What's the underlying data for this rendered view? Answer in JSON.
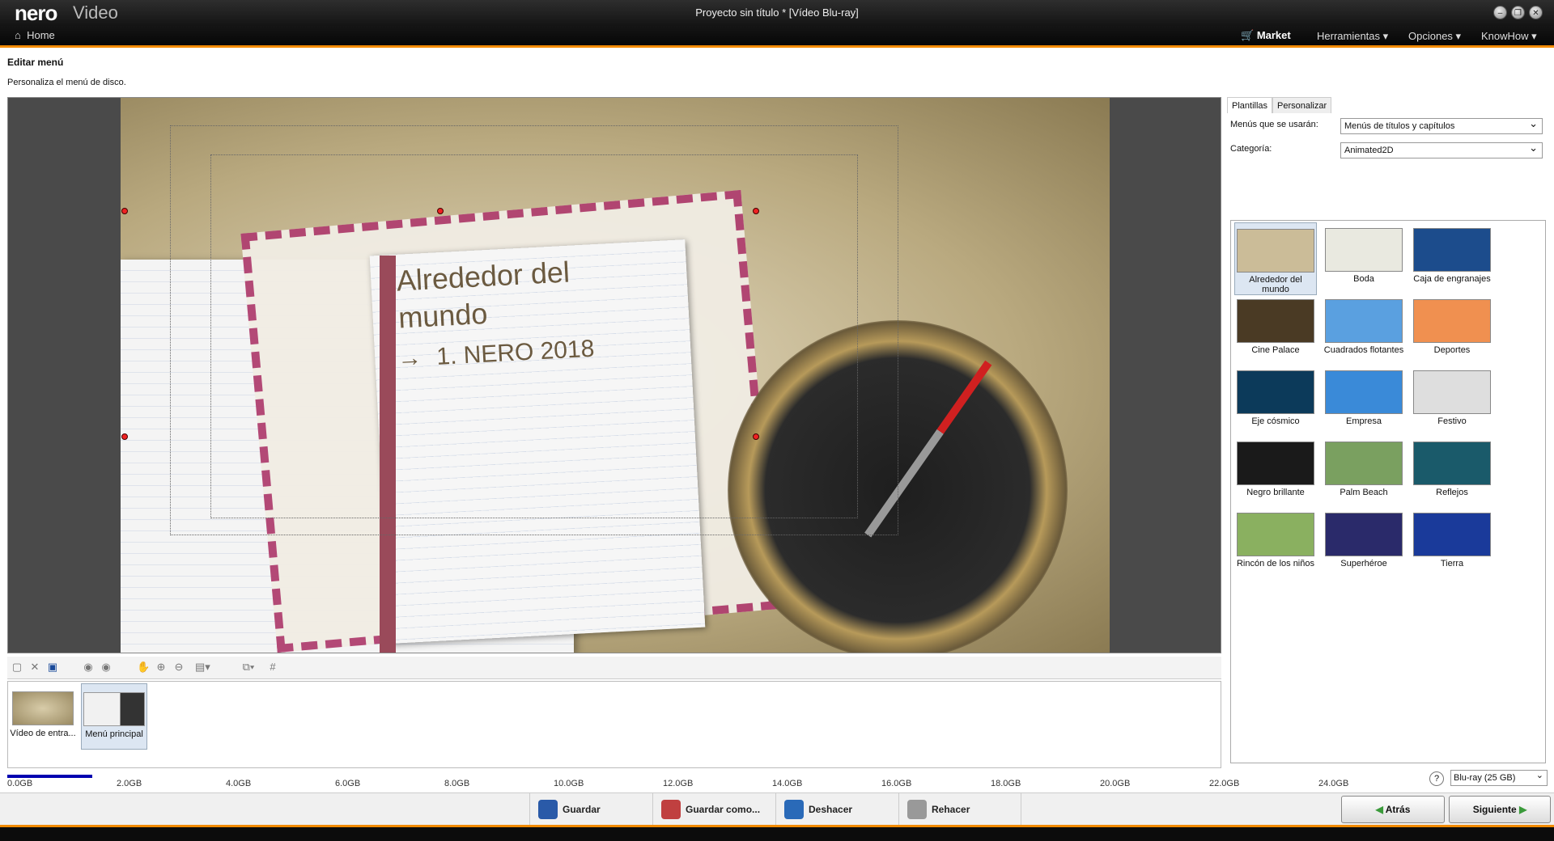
{
  "app": {
    "brand": "nero",
    "name": "Video",
    "title": "Proyecto sin título * [Vídeo Blu-ray]"
  },
  "menubar": {
    "home": "Home",
    "market": "Market",
    "items": [
      "Herramientas ▾",
      "Opciones ▾",
      "KnowHow ▾"
    ]
  },
  "page": {
    "title": "Editar menú",
    "description": "Personaliza el menú de disco."
  },
  "preview": {
    "heading_line1": "Alrededor del",
    "heading_line2": "mundo",
    "item": "1. NERO 2018",
    "arrow": "→"
  },
  "toolbar": {
    "icons": [
      "new-icon",
      "delete-icon",
      "save-icon",
      "back-icon",
      "forward-icon",
      "hand-icon",
      "zoom-in-icon",
      "zoom-out-icon",
      "layout-icon",
      "arrange-icon",
      "grid-icon"
    ]
  },
  "thumbnails": [
    {
      "label": "Vídeo de entra..."
    },
    {
      "label": "Menú principal"
    }
  ],
  "capacity": {
    "used_fraction": 0.07,
    "ticks": [
      "0.0GB",
      "2.0GB",
      "4.0GB",
      "6.0GB",
      "8.0GB",
      "10.0GB",
      "12.0GB",
      "14.0GB",
      "16.0GB",
      "18.0GB",
      "20.0GB",
      "22.0GB",
      "24.0GB"
    ],
    "disc": "Blu-ray (25 GB)"
  },
  "actions": {
    "save": "Guardar",
    "save_as": "Guardar como...",
    "undo": "Deshacer",
    "redo": "Rehacer"
  },
  "nav": {
    "back": "Atrás",
    "next": "Siguiente"
  },
  "panel": {
    "tabs": [
      "Plantillas",
      "Personalizar"
    ],
    "menus_label": "Menús que se usarán:",
    "menus_value": "Menús de títulos y capítulos",
    "category_label": "Categoría:",
    "category_value": "Animated2D",
    "templates": [
      {
        "label": "Alrededor del mundo",
        "color": "#cbbc98"
      },
      {
        "label": "Boda",
        "color": "#e9e9e0"
      },
      {
        "label": "Caja de engranajes",
        "color": "#1c4c8c"
      },
      {
        "label": "Cine Palace",
        "color": "#4a3a24"
      },
      {
        "label": "Cuadrados flotantes",
        "color": "#5aa0e0"
      },
      {
        "label": "Deportes",
        "color": "#f09050"
      },
      {
        "label": "Eje cósmico",
        "color": "#0c3a5a"
      },
      {
        "label": "Empresa",
        "color": "#3a8ad8"
      },
      {
        "label": "Festivo",
        "color": "#dedede"
      },
      {
        "label": "Negro brillante",
        "color": "#1a1a1a"
      },
      {
        "label": "Palm Beach",
        "color": "#7aa060"
      },
      {
        "label": "Reflejos",
        "color": "#1a5a6a"
      },
      {
        "label": "Rincón de los niños",
        "color": "#8ab060"
      },
      {
        "label": "Superhéroe",
        "color": "#2a2a6a"
      },
      {
        "label": "Tierra",
        "color": "#1a3a9a"
      }
    ]
  },
  "colors": {
    "accent": "#f28a00",
    "progress": "#0000b0"
  }
}
